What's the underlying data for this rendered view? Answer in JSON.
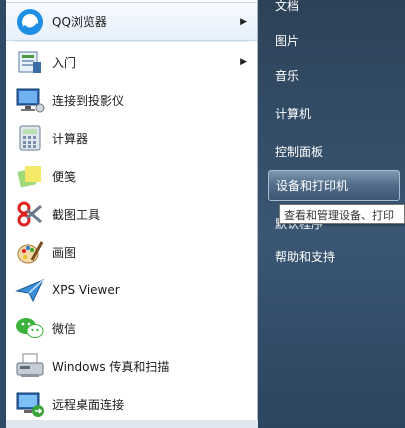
{
  "left_menu": {
    "items": [
      {
        "label": "QQ浏览器",
        "icon": "qq-browser-icon",
        "has_submenu": true
      },
      {
        "label": "入门",
        "icon": "getting-started-icon",
        "has_submenu": true
      },
      {
        "label": "连接到投影仪",
        "icon": "projector-icon",
        "has_submenu": false
      },
      {
        "label": "计算器",
        "icon": "calculator-icon",
        "has_submenu": false
      },
      {
        "label": "便笺",
        "icon": "sticky-notes-icon",
        "has_submenu": false
      },
      {
        "label": "截图工具",
        "icon": "snipping-tool-icon",
        "has_submenu": false
      },
      {
        "label": "画图",
        "icon": "paint-icon",
        "has_submenu": false
      },
      {
        "label": "XPS Viewer",
        "icon": "xps-viewer-icon",
        "has_submenu": false
      },
      {
        "label": "微信",
        "icon": "wechat-icon",
        "has_submenu": false
      },
      {
        "label": "Windows 传真和扫描",
        "icon": "fax-scan-icon",
        "has_submenu": false
      },
      {
        "label": "远程桌面连接",
        "icon": "remote-desktop-icon",
        "has_submenu": false
      }
    ]
  },
  "right_menu": {
    "items": [
      {
        "label": "文档"
      },
      {
        "label": "图片"
      },
      {
        "label": "音乐"
      },
      {
        "label": "计算机"
      },
      {
        "label": "控制面板"
      },
      {
        "label": "设备和打印机",
        "highlighted": true
      },
      {
        "label": "默认程序"
      },
      {
        "label": "帮助和支持"
      }
    ]
  },
  "tooltip": {
    "text": "查看和管理设备、打印"
  },
  "colors": {
    "highlight": "#55708d",
    "right_bg": "#3a5673",
    "left_bg": "#ffffff"
  }
}
